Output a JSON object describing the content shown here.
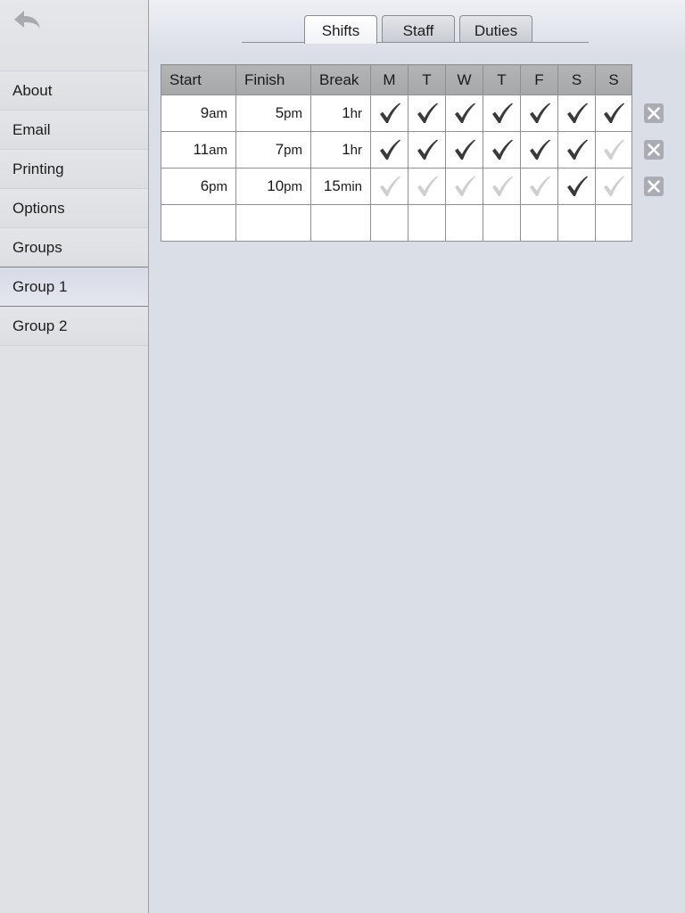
{
  "sidebar": {
    "back_icon": "back-arrow-icon",
    "items": [
      {
        "label": "About"
      },
      {
        "label": "Email"
      },
      {
        "label": "Printing"
      },
      {
        "label": "Options"
      },
      {
        "label": "Groups"
      },
      {
        "label": "Group 1",
        "selected": true
      },
      {
        "label": "Group 2"
      }
    ]
  },
  "tabs": [
    {
      "label": "Shifts",
      "active": true
    },
    {
      "label": "Staff",
      "active": false
    },
    {
      "label": "Duties",
      "active": false
    }
  ],
  "table": {
    "headers": [
      "Start",
      "Finish",
      "Break",
      "M",
      "T",
      "W",
      "T",
      "F",
      "S",
      "S"
    ],
    "rows": [
      {
        "start": {
          "num": "9",
          "unit": "am"
        },
        "finish": {
          "num": "5",
          "unit": "pm"
        },
        "break": {
          "num": "1",
          "unit": "hr"
        },
        "days": [
          true,
          true,
          true,
          true,
          true,
          true,
          true
        ]
      },
      {
        "start": {
          "num": "11",
          "unit": "am"
        },
        "finish": {
          "num": "7",
          "unit": "pm"
        },
        "break": {
          "num": "1",
          "unit": "hr"
        },
        "days": [
          true,
          true,
          true,
          true,
          true,
          true,
          false
        ]
      },
      {
        "start": {
          "num": "6",
          "unit": "pm"
        },
        "finish": {
          "num": "10",
          "unit": "pm"
        },
        "break": {
          "num": "15",
          "unit": "min"
        },
        "days": [
          false,
          false,
          false,
          false,
          false,
          true,
          false
        ]
      }
    ],
    "empty_rows": 1
  },
  "colors": {
    "check_on": "#3a3a3a",
    "check_off": "#cfcfcf",
    "delete_icon": "#a9acb2",
    "header_bg": "#acadaf",
    "selected_item": "#dfe2ea"
  },
  "icons": {
    "check": "checkmark-icon",
    "delete": "delete-x-icon"
  }
}
